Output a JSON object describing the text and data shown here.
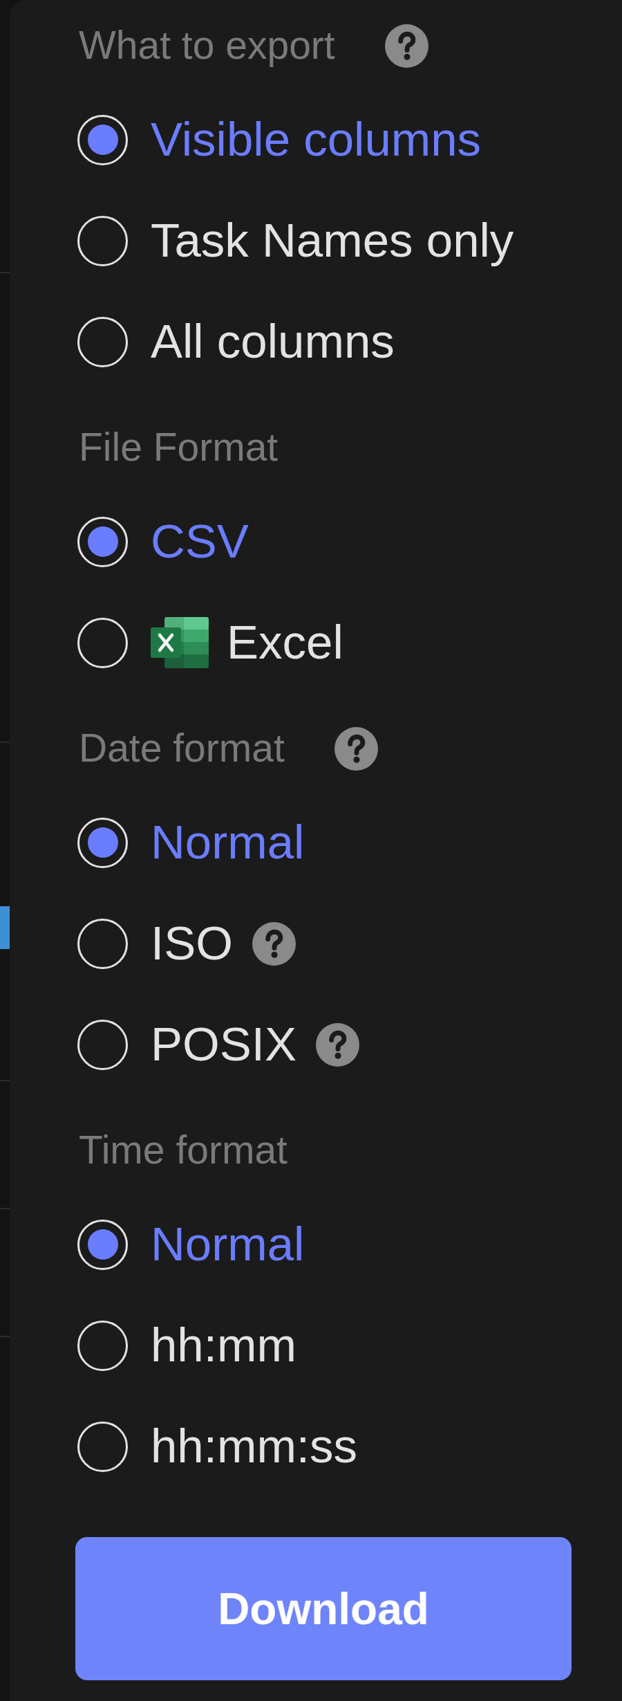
{
  "sections": [
    {
      "title": "What to export",
      "help": true,
      "options": [
        {
          "label": "Visible columns",
          "selected": true,
          "kind": "text",
          "help": false
        },
        {
          "label": "Task Names only",
          "selected": false,
          "kind": "text",
          "help": false
        },
        {
          "label": "All columns",
          "selected": false,
          "kind": "text",
          "help": false
        }
      ]
    },
    {
      "title": "File Format",
      "help": false,
      "options": [
        {
          "label": "CSV",
          "selected": true,
          "kind": "text",
          "help": false
        },
        {
          "label": "Excel",
          "selected": false,
          "kind": "spreadsheet",
          "help": false
        }
      ]
    },
    {
      "title": "Date format",
      "help": true,
      "options": [
        {
          "label": "Normal",
          "selected": true,
          "kind": "text",
          "help": false
        },
        {
          "label": "ISO",
          "selected": false,
          "kind": "text",
          "help": true
        },
        {
          "label": "POSIX",
          "selected": false,
          "kind": "text",
          "help": true
        }
      ]
    },
    {
      "title": "Time format",
      "help": false,
      "options": [
        {
          "label": "Normal",
          "selected": true,
          "kind": "text",
          "help": false
        },
        {
          "label": "hh:mm",
          "selected": false,
          "kind": "text",
          "help": false
        },
        {
          "label": "hh:mm:ss",
          "selected": false,
          "kind": "text",
          "help": false
        }
      ]
    }
  ],
  "download_button": {
    "label": "Download"
  }
}
